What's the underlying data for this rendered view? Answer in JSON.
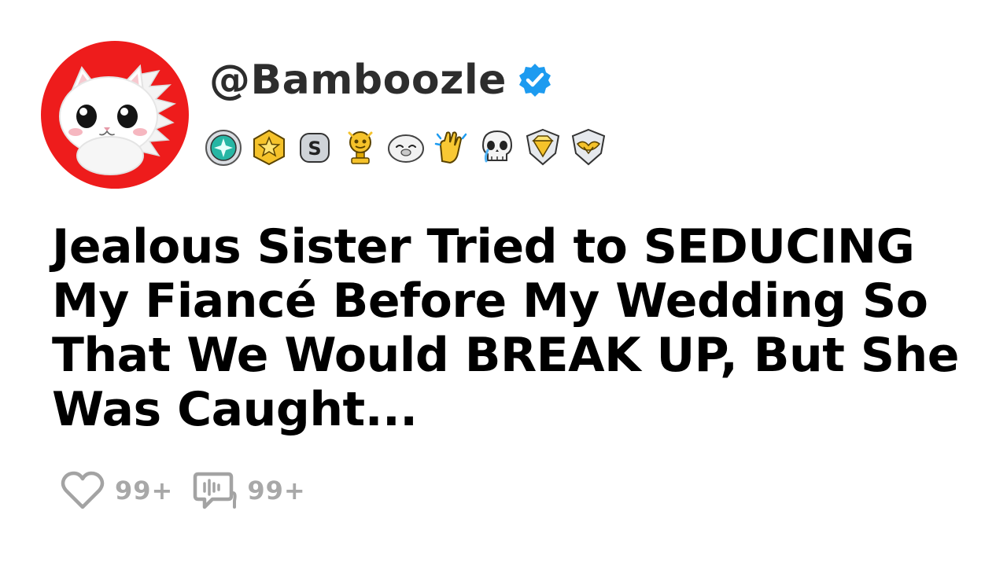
{
  "profile": {
    "username": "@Bamboozle",
    "verified": true,
    "avatar_bg": "#ee1c1c"
  },
  "badges": [
    "gem-badge-icon",
    "star-badge-icon",
    "silver-s-badge-icon",
    "gold-trophy-icon",
    "seal-face-icon",
    "clapping-hands-icon",
    "crying-skull-icon",
    "diamond-shield-icon",
    "wings-shield-icon"
  ],
  "post": {
    "title": "Jealous Sister Tried to SEDUCING My Fiancé Before My Wedding So That We Would BREAK UP, But She Was Caught..."
  },
  "stats": {
    "likes": "99+",
    "comments": "99+"
  },
  "colors": {
    "verified_blue": "#1d9bf0",
    "muted_gray": "#a3a3a3",
    "gold": "#f5c22a"
  }
}
